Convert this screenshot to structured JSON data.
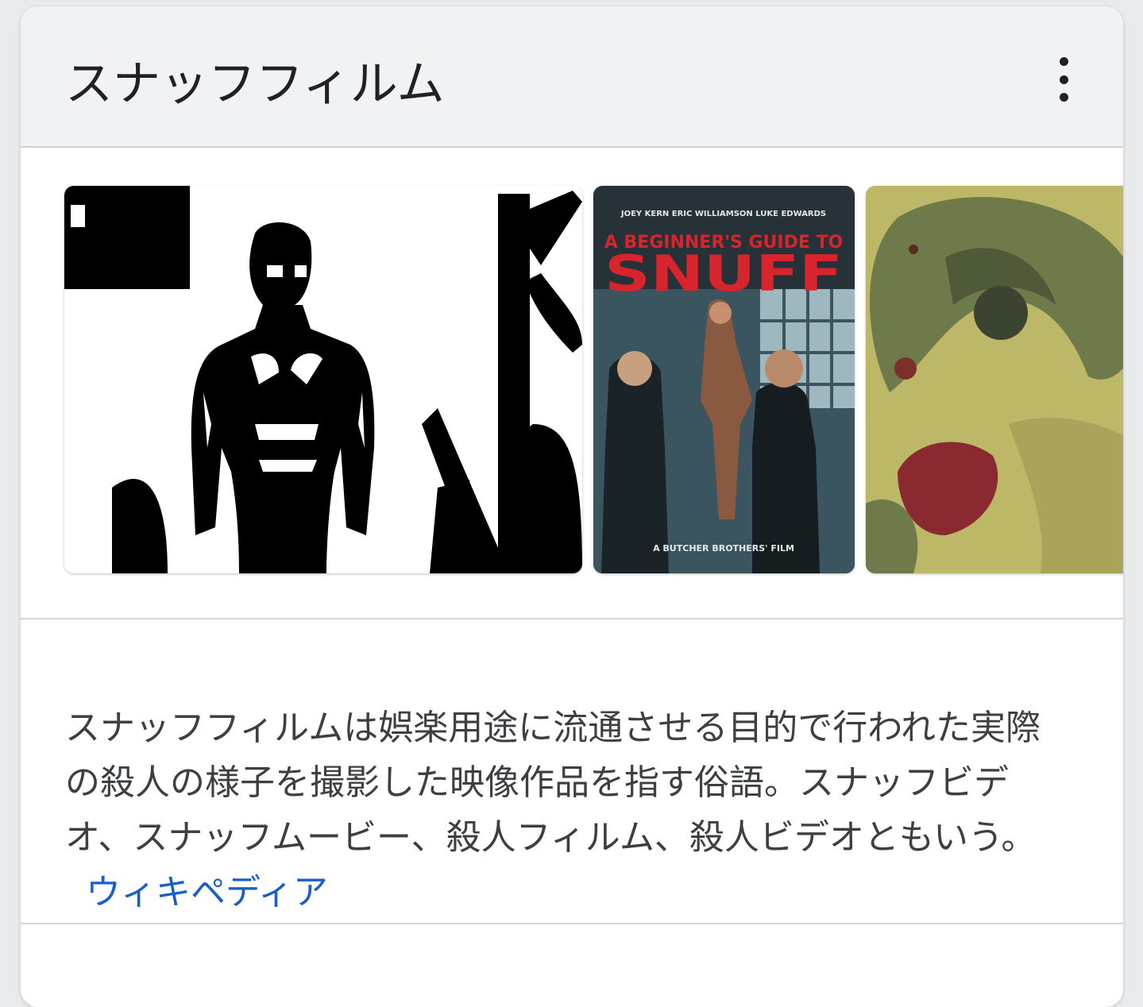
{
  "knowledge_panel": {
    "title": "スナッフフィルム",
    "menu_icon": "more-vert-icon",
    "images": [
      {
        "name": "high-contrast-portrait"
      },
      {
        "name": "movie-poster",
        "cast": [
          "JOEY KERN",
          "ERIC WILLIAMSON",
          "LUKE EDWARDS"
        ],
        "poster_title_line1": "A BEGINNER'S GUIDE TO",
        "poster_title_line2": "SNUFF",
        "poster_credit": "A BUTCHER BROTHERS' FILM"
      },
      {
        "name": "illustration"
      }
    ],
    "description": "スナッフフィルムは娯楽用途に流通させる目的で行われた実際の殺人の様子を撮影した映像作品を指す俗語。スナッフビデオ、スナッフムービー、殺人フィルム、殺人ビデオともいう。",
    "source_link": "ウィキペディア",
    "colors": {
      "link": "#1a5fc9",
      "text": "#3c4043",
      "header_bg": "#f1f2f4",
      "poster_red": "#d8252d"
    }
  }
}
